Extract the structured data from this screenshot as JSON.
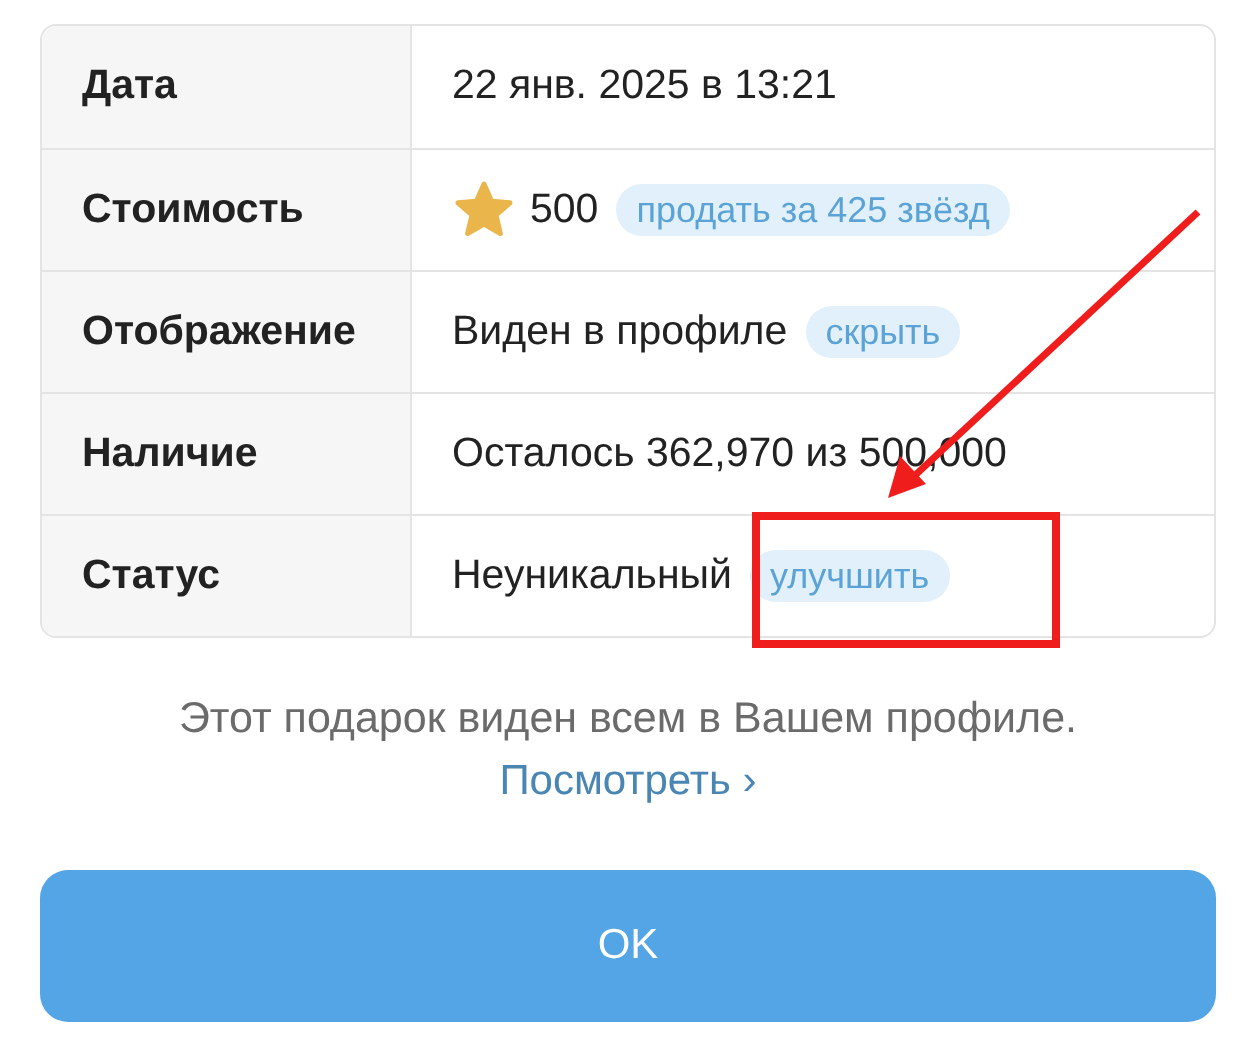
{
  "details": [
    {
      "label": "Дата",
      "kind": "text",
      "value": "22 янв. 2025 в 13:21"
    },
    {
      "label": "Стоимость",
      "kind": "price",
      "value": "500",
      "action": "продать за 425 звёзд"
    },
    {
      "label": "Отображение",
      "kind": "text",
      "value": "Виден в профиле",
      "action": "скрыть"
    },
    {
      "label": "Наличие",
      "kind": "text",
      "value": "Осталось 362,970 из 500,000"
    },
    {
      "label": "Статус",
      "kind": "text",
      "value": "Неуникальный",
      "action": "улучшить"
    }
  ],
  "note": "Этот подарок виден всем в Вашем профиле.",
  "link": {
    "label": "Посмотреть",
    "chevron": "›"
  },
  "ok_button": "OK",
  "annotations": {
    "arrow": true,
    "highlight_box": true
  }
}
